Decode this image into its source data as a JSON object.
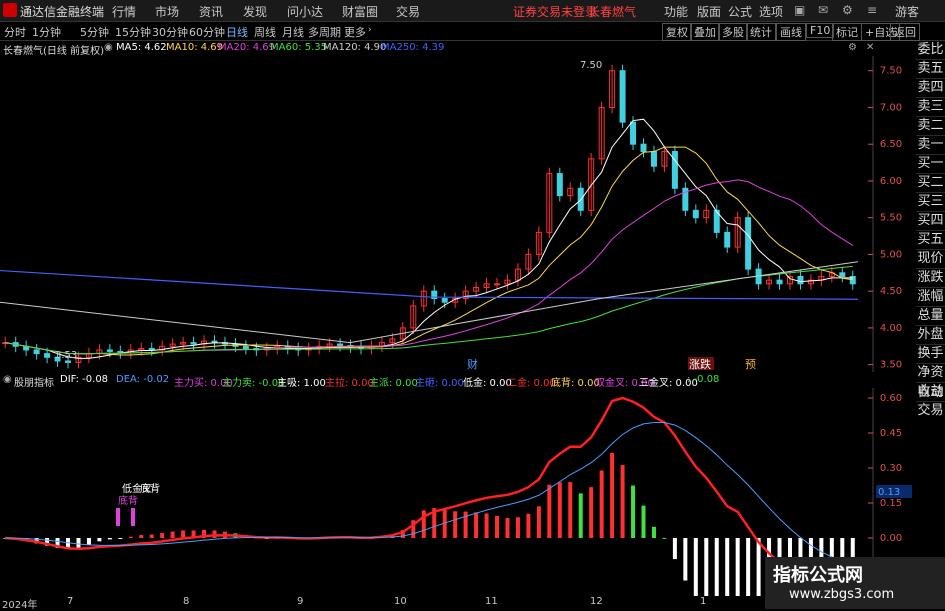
{
  "app": {
    "title": "通达信金融终端",
    "menu": [
      "行情",
      "市场",
      "资讯",
      "发现",
      "问小达",
      "财富圈",
      "交易"
    ],
    "notice": "证券交易未登录",
    "stock_title": "长春燃气",
    "top_right": [
      "功能",
      "版面",
      "公式",
      "选项"
    ],
    "user": "游客"
  },
  "toolbar": {
    "periods": [
      "分时",
      "1分钟",
      "5分钟",
      "15分钟",
      "30分钟",
      "60分钟",
      "日线",
      "周线",
      "月线",
      "多周期",
      "更多"
    ],
    "active_period": "日线",
    "right_buttons": [
      "复权",
      "叠加",
      "多股",
      "统计",
      "画线",
      "F10",
      "标记",
      "+自选",
      "返回"
    ]
  },
  "info": {
    "name": "长春燃气(日线 前复权)",
    "ma": [
      {
        "label": "MA5: 4.62",
        "color": "#ffffff"
      },
      {
        "label": "MA10: 4.69",
        "color": "#ffd84a"
      },
      {
        "label": "MA20: 4.69",
        "color": "#e040e0"
      },
      {
        "label": "MA60: 5.35",
        "color": "#40e040"
      },
      {
        "label": "MA120: 4.90",
        "color": "#cccccc"
      },
      {
        "label": "MA250: 4.39",
        "color": "#4060ff"
      }
    ]
  },
  "macd_info": {
    "name": "股朋指标",
    "items": [
      {
        "label": "DIF: -0.08",
        "color": "#ffffff"
      },
      {
        "label": "DEA: -0.02",
        "color": "#4a9dff"
      },
      {
        "label": "主力买: 0.00",
        "color": "#e040e0"
      },
      {
        "label": "主力卖: -0.08",
        "color": "#40e040"
      },
      {
        "label": "主吸: 1.00",
        "color": "#ffffff"
      },
      {
        "label": "主拉: 0.00",
        "color": "#ff3030"
      },
      {
        "label": "主派: 0.00",
        "color": "#40e040"
      },
      {
        "label": "主砸: 0.00",
        "color": "#4060ff"
      },
      {
        "label": "低金: 0.00",
        "color": "#ffffff"
      },
      {
        "label": "二金: 0.00",
        "color": "#ff3030"
      },
      {
        "label": "底背: 0.00",
        "color": "#ffd84a"
      },
      {
        "label": "双金叉: 0.00",
        "color": "#e040e0"
      },
      {
        "label": "三金叉: 0.00",
        "color": "#ffffff"
      },
      {
        "label": ": -0.08",
        "color": "#40e040"
      }
    ]
  },
  "right_panel": [
    "委比",
    "卖五",
    "卖四",
    "卖三",
    "卖二",
    "卖一",
    "买一",
    "买二",
    "买三",
    "买四",
    "买五",
    "现价",
    "涨跌",
    "涨幅",
    "总量",
    "外盘",
    "换手",
    "净资",
    "收益"
  ],
  "right_panel2": [
    "自动",
    "交易"
  ],
  "price_axis": [
    "7.50",
    "7.00",
    "6.50",
    "6.00",
    "5.50",
    "5.00",
    "4.50",
    "4.00",
    "3.50"
  ],
  "macd_axis": [
    "0.60",
    "0.45",
    "0.30",
    "0.15",
    "0.00"
  ],
  "macd_current": "0.13",
  "price_labels": {
    "high": "7.50",
    "low": "3.53"
  },
  "annotations": {
    "cai": "财",
    "zhangdie": "涨跌",
    "yu": "预",
    "dijin": "低金叉",
    "dibei": "底背"
  },
  "x_axis": [
    "2024年",
    "7",
    "8",
    "9",
    "10",
    "11",
    "12",
    "1"
  ],
  "watermark": {
    "title": "指标公式网",
    "url": "www.zbgs3.com"
  },
  "chart_data": {
    "type": "candlestick",
    "closes": [
      3.8,
      3.75,
      3.7,
      3.65,
      3.6,
      3.55,
      3.53,
      3.6,
      3.65,
      3.7,
      3.68,
      3.66,
      3.7,
      3.72,
      3.7,
      3.75,
      3.78,
      3.8,
      3.78,
      3.82,
      3.8,
      3.78,
      3.75,
      3.72,
      3.7,
      3.72,
      3.75,
      3.72,
      3.7,
      3.72,
      3.75,
      3.78,
      3.76,
      3.74,
      3.72,
      3.75,
      3.8,
      3.85,
      4.0,
      4.3,
      4.5,
      4.4,
      4.35,
      4.4,
      4.5,
      4.55,
      4.6,
      4.6,
      4.65,
      4.8,
      5.0,
      5.3,
      6.1,
      5.8,
      5.9,
      5.6,
      6.3,
      7.0,
      7.5,
      6.8,
      6.5,
      6.4,
      6.2,
      6.4,
      5.9,
      5.6,
      5.5,
      5.6,
      5.3,
      5.1,
      5.5,
      4.8,
      4.6,
      4.65,
      4.6,
      4.7,
      4.6,
      4.65,
      4.7,
      4.75,
      4.7,
      4.6
    ],
    "y_range": [
      3.4,
      7.7
    ]
  }
}
